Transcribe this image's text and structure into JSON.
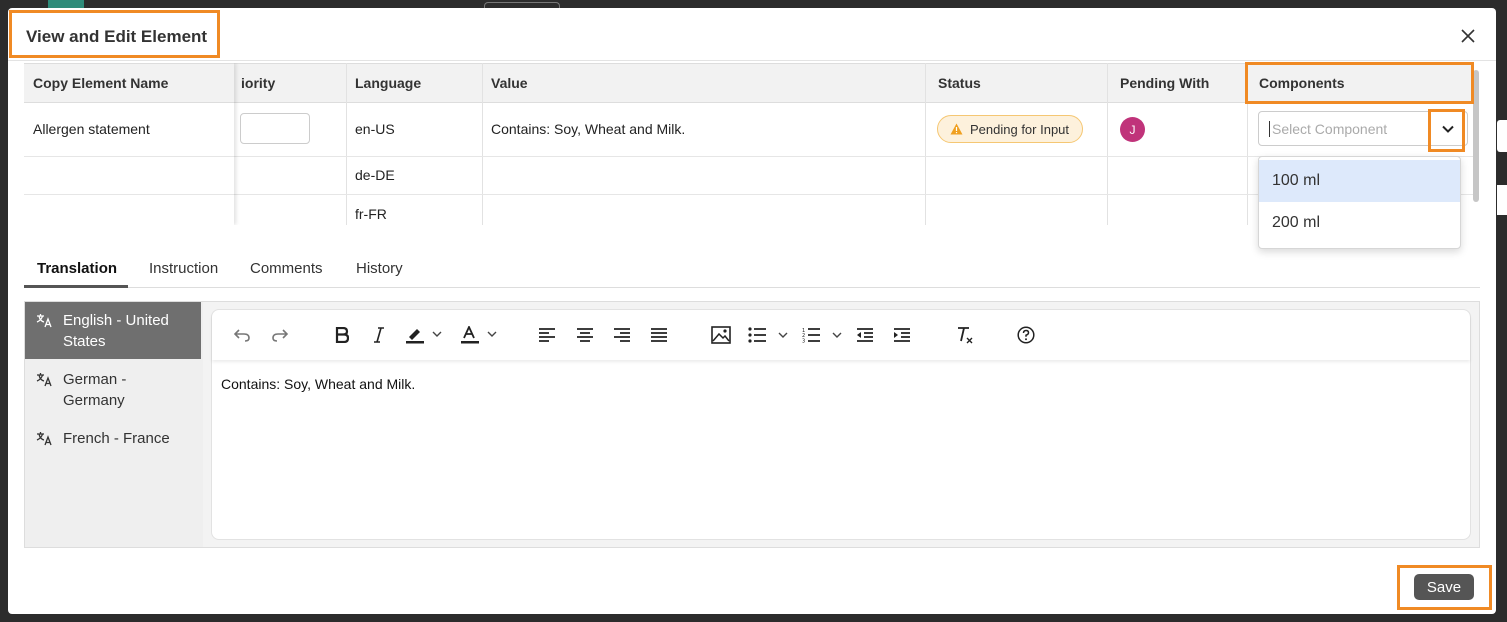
{
  "dialog": {
    "title": "View and Edit Element"
  },
  "table": {
    "headers": {
      "name": "Copy Element Name",
      "priority": "iority",
      "language": "Language",
      "value": "Value",
      "status": "Status",
      "pending": "Pending With",
      "components": "Components"
    },
    "rows": [
      {
        "name": "Allergen statement",
        "language": "en-US",
        "value": "Contains: Soy, Wheat and Milk.",
        "status": "Pending for Input",
        "pending_avatar": "J"
      },
      {
        "name": "",
        "language": "de-DE",
        "value": ""
      },
      {
        "name": "",
        "language": "fr-FR",
        "value": ""
      }
    ],
    "component_placeholder": "Select Component"
  },
  "dropdown": {
    "options": [
      "100 ml",
      "200 ml"
    ],
    "highlighted": "100 ml"
  },
  "tabs": [
    "Translation",
    "Instruction",
    "Comments",
    "History"
  ],
  "active_tab": "Translation",
  "languages": [
    {
      "label": "English - United States",
      "active": true
    },
    {
      "label": "German - Germany",
      "active": false
    },
    {
      "label": "French - France",
      "active": false
    }
  ],
  "editor": {
    "content": "Contains: Soy, Wheat and Milk.",
    "toolbar_icons": [
      "undo-icon",
      "redo-icon",
      "bold-icon",
      "italic-icon",
      "highlight-icon",
      "font-color-icon",
      "align-left-icon",
      "align-center-icon",
      "align-right-icon",
      "justify-icon",
      "image-icon",
      "bullet-list-icon",
      "numbered-list-icon",
      "outdent-icon",
      "indent-icon",
      "clear-format-icon",
      "help-icon"
    ]
  },
  "footer": {
    "save_label": "Save"
  },
  "colors": {
    "highlight": "#f08a24",
    "avatar": "#c0337a",
    "badge_bg": "#fdf1dc",
    "badge_icon": "#f0a020",
    "active_lang_bg": "#6f6f6f",
    "dropdown_active": "#dde9fb"
  }
}
